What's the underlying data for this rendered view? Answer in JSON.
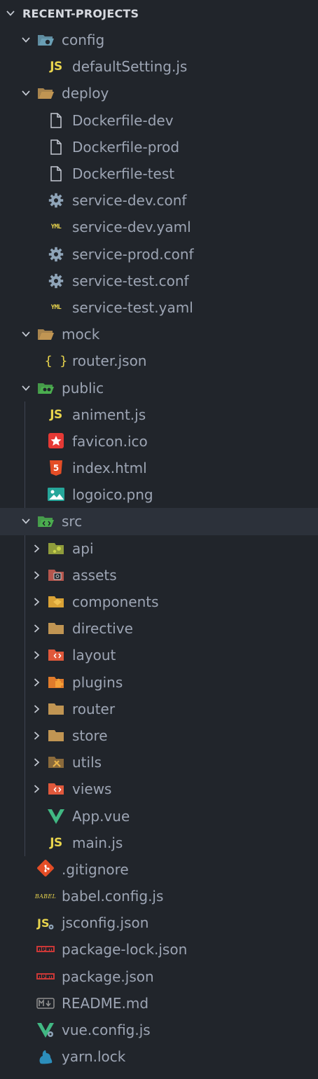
{
  "explorer": {
    "title": "RECENT-PROJECTS"
  },
  "tree": [
    {
      "label": "config",
      "depth": 1,
      "type": "folder-open",
      "icon": "config-folder-icon"
    },
    {
      "label": "defaultSetting.js",
      "depth": 2,
      "type": "file",
      "icon": "js-icon"
    },
    {
      "label": "deploy",
      "depth": 1,
      "type": "folder-open",
      "icon": "folder-open-icon"
    },
    {
      "label": "Dockerfile-dev",
      "depth": 2,
      "type": "file",
      "icon": "file-icon"
    },
    {
      "label": "Dockerfile-prod",
      "depth": 2,
      "type": "file",
      "icon": "file-icon"
    },
    {
      "label": "Dockerfile-test",
      "depth": 2,
      "type": "file",
      "icon": "file-icon"
    },
    {
      "label": "service-dev.conf",
      "depth": 2,
      "type": "file",
      "icon": "gear-icon"
    },
    {
      "label": "service-dev.yaml",
      "depth": 2,
      "type": "file",
      "icon": "yaml-icon"
    },
    {
      "label": "service-prod.conf",
      "depth": 2,
      "type": "file",
      "icon": "gear-icon"
    },
    {
      "label": "service-test.conf",
      "depth": 2,
      "type": "file",
      "icon": "gear-icon"
    },
    {
      "label": "service-test.yaml",
      "depth": 2,
      "type": "file",
      "icon": "yaml-icon"
    },
    {
      "label": "mock",
      "depth": 1,
      "type": "folder-open",
      "icon": "folder-open-icon"
    },
    {
      "label": "router.json",
      "depth": 2,
      "type": "file",
      "icon": "json-icon"
    },
    {
      "label": "public",
      "depth": 1,
      "type": "folder-open",
      "icon": "public-folder-icon"
    },
    {
      "label": "animent.js",
      "depth": 2,
      "type": "file",
      "icon": "js-icon"
    },
    {
      "label": "favicon.ico",
      "depth": 2,
      "type": "file",
      "icon": "favicon-icon"
    },
    {
      "label": "index.html",
      "depth": 2,
      "type": "file",
      "icon": "html5-icon"
    },
    {
      "label": "logoico.png",
      "depth": 2,
      "type": "file",
      "icon": "image-icon"
    },
    {
      "label": "src",
      "depth": 1,
      "type": "folder-open",
      "icon": "src-folder-icon",
      "selected": true
    },
    {
      "label": "api",
      "depth": 2,
      "type": "folder",
      "icon": "api-folder-icon"
    },
    {
      "label": "assets",
      "depth": 2,
      "type": "folder",
      "icon": "assets-folder-icon"
    },
    {
      "label": "components",
      "depth": 2,
      "type": "folder",
      "icon": "components-folder-icon"
    },
    {
      "label": "directive",
      "depth": 2,
      "type": "folder",
      "icon": "folder-icon"
    },
    {
      "label": "layout",
      "depth": 2,
      "type": "folder",
      "icon": "layout-folder-icon"
    },
    {
      "label": "plugins",
      "depth": 2,
      "type": "folder",
      "icon": "plugins-folder-icon"
    },
    {
      "label": "router",
      "depth": 2,
      "type": "folder",
      "icon": "folder-icon"
    },
    {
      "label": "store",
      "depth": 2,
      "type": "folder",
      "icon": "folder-icon"
    },
    {
      "label": "utils",
      "depth": 2,
      "type": "folder",
      "icon": "utils-folder-icon"
    },
    {
      "label": "views",
      "depth": 2,
      "type": "folder",
      "icon": "views-folder-icon"
    },
    {
      "label": "App.vue",
      "depth": 2,
      "type": "file",
      "icon": "vue-icon"
    },
    {
      "label": "main.js",
      "depth": 2,
      "type": "file",
      "icon": "js-icon"
    },
    {
      "label": ".gitignore",
      "depth": 1,
      "type": "file",
      "icon": "git-icon"
    },
    {
      "label": "babel.config.js",
      "depth": 1,
      "type": "file",
      "icon": "babel-icon"
    },
    {
      "label": "jsconfig.json",
      "depth": 1,
      "type": "file",
      "icon": "jsconfig-icon"
    },
    {
      "label": "package-lock.json",
      "depth": 1,
      "type": "file",
      "icon": "npm-icon"
    },
    {
      "label": "package.json",
      "depth": 1,
      "type": "file",
      "icon": "npm-icon"
    },
    {
      "label": "README.md",
      "depth": 1,
      "type": "file",
      "icon": "markdown-icon"
    },
    {
      "label": "vue.config.js",
      "depth": 1,
      "type": "file",
      "icon": "vue-config-icon"
    },
    {
      "label": "yarn.lock",
      "depth": 1,
      "type": "file",
      "icon": "yarn-icon"
    }
  ],
  "icon_glyphs": {
    "js": "JS",
    "json": "{ }",
    "yaml": "YML",
    "babel": "BABEL"
  },
  "colors": {
    "background": "#21252b",
    "selected_row": "#2c313a",
    "text": "#9da5b4",
    "folder": "#c09553",
    "js": "#e8d44d",
    "vue": "#41b883",
    "html": "#e44d26",
    "config_folder": "#6a9fb5",
    "public_folder": "#4bae4f"
  }
}
